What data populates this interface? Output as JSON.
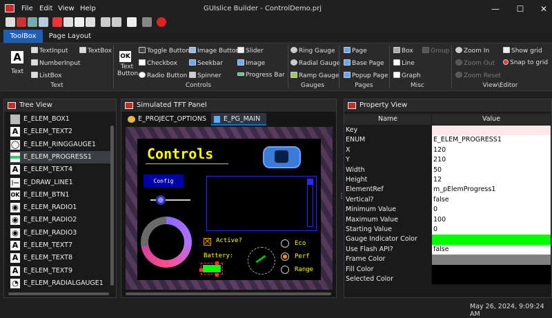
{
  "window": {
    "title": "GUIslice Builder - ControlDemo.prj",
    "menu": [
      "File",
      "Edit",
      "View",
      "Help"
    ],
    "controls": {
      "minimize": "—",
      "maximize": "☐",
      "close": "✕"
    }
  },
  "tabs": [
    {
      "label": "ToolBox",
      "active": true
    },
    {
      "label": "Page Layout",
      "active": false
    }
  ],
  "ribbon": {
    "text": {
      "big": "Text",
      "items": [
        "TextInput",
        "NumberInput",
        "ListBox",
        "TextBox"
      ],
      "group": "Text"
    },
    "controls": {
      "big": "Text Button",
      "items": [
        "Toggle Button",
        "Checkbox",
        "Radio Button",
        "Image Button",
        "Seekbar",
        "Spinner",
        "Slider",
        "Image",
        "Progress Bar"
      ],
      "group": "Controls"
    },
    "gauges": {
      "items": [
        "Ring Gauge",
        "Radial Gauge",
        "Ramp Gauge"
      ],
      "group": "Gauges"
    },
    "pages": {
      "items": [
        "Page",
        "Base Page",
        "Popup Page"
      ],
      "group": "Pages"
    },
    "misc": {
      "items": [
        "Box",
        "Group",
        "Line",
        "Graph"
      ],
      "group": "Misc"
    },
    "view": {
      "items": [
        "Zoom In",
        "Zoom Out",
        "Zoom Reset",
        "Show grid",
        "Snap to grid"
      ],
      "group": "View\\Editor"
    }
  },
  "tree": {
    "title": "Tree View",
    "items": [
      {
        "icon": "box-icon",
        "glyph": "",
        "label": "E_ELEM_BOX1"
      },
      {
        "icon": "text-icon",
        "glyph": "A",
        "label": "E_ELEM_TEXT2"
      },
      {
        "icon": "ring-gauge-icon",
        "glyph": "◯",
        "label": "E_ELEM_RINGGAUGE1"
      },
      {
        "icon": "progress-bar-icon",
        "glyph": "",
        "label": "E_ELEM_PROGRESS1",
        "selected": true
      },
      {
        "icon": "text-icon",
        "glyph": "A",
        "label": "E_ELEM_TEXT4"
      },
      {
        "icon": "line-icon",
        "glyph": "|—",
        "label": "E_DRAW_LINE1"
      },
      {
        "icon": "button-icon",
        "glyph": "OK",
        "label": "E_ELEM_BTN1"
      },
      {
        "icon": "radio-icon",
        "glyph": "◉",
        "label": "E_ELEM_RADIO1"
      },
      {
        "icon": "radio-icon",
        "glyph": "◉",
        "label": "E_ELEM_RADIO2"
      },
      {
        "icon": "radio-icon",
        "glyph": "◉",
        "label": "E_ELEM_RADIO3"
      },
      {
        "icon": "text-icon",
        "glyph": "A",
        "label": "E_ELEM_TEXT7"
      },
      {
        "icon": "text-icon",
        "glyph": "A",
        "label": "E_ELEM_TEXT8"
      },
      {
        "icon": "text-icon",
        "glyph": "A",
        "label": "E_ELEM_TEXT9"
      },
      {
        "icon": "radial-gauge-icon",
        "glyph": "◔",
        "label": "E_ELEM_RADIALGAUGE1"
      }
    ]
  },
  "tft": {
    "title": "Simulated TFT Panel",
    "tabs": [
      {
        "label": "E_PROJECT_OPTIONS",
        "active": false
      },
      {
        "label": "E_PG_MAIN",
        "active": true
      }
    ],
    "heading": "Controls",
    "config": "Config",
    "active": "Active?",
    "battery": "Battery:",
    "radios": [
      "Eco",
      "Perf",
      "Range"
    ]
  },
  "props": {
    "title": "Property View",
    "header": {
      "name": "Name",
      "value": "Value"
    },
    "rows": [
      {
        "name": "Key",
        "value": "",
        "bg": "#fde7e7"
      },
      {
        "name": "ENUM",
        "value": "E_ELEM_PROGRESS1",
        "bg": "#ffffff"
      },
      {
        "name": "X",
        "value": "120",
        "bg": "#ffffff"
      },
      {
        "name": "Y",
        "value": "210",
        "bg": "#ffffff"
      },
      {
        "name": "Width",
        "value": "50",
        "bg": "#ffffff"
      },
      {
        "name": "Height",
        "value": "12",
        "bg": "#ffffff"
      },
      {
        "name": "ElementRef",
        "value": "m_pElemProgress1",
        "bg": "#ffffff"
      },
      {
        "name": "Vertical?",
        "value": "false",
        "bg": "#ffffff"
      },
      {
        "name": "Minimum Value",
        "value": "0",
        "bg": "#ffffff"
      },
      {
        "name": "Maximum Value",
        "value": "100",
        "bg": "#ffffff"
      },
      {
        "name": "Starting Value",
        "value": "0",
        "bg": "#ffffff"
      },
      {
        "name": "Gauge Indicator Color",
        "value": "",
        "bg": "#00ff00"
      },
      {
        "name": "Use Flash API?",
        "value": "false",
        "bg": "#ffffff"
      },
      {
        "name": "Frame Color",
        "value": "",
        "bg": "#808080"
      },
      {
        "name": "Fill Color",
        "value": "",
        "bg": "#000000"
      },
      {
        "name": "Selected Color",
        "value": "",
        "bg": "#000000"
      }
    ]
  },
  "status": "May 26, 2024, 9:09:24 AM",
  "colors": {
    "accent": "#0078d4",
    "tabActive": "#1e5fb4",
    "tftText": "#ffff00",
    "progress": "#00ff00"
  }
}
